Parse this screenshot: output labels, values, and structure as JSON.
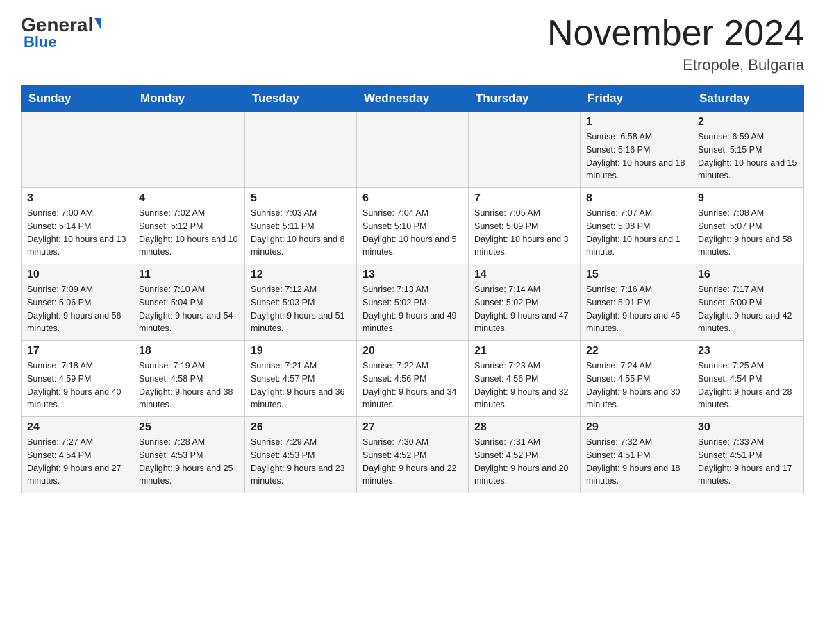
{
  "header": {
    "logo": {
      "general": "General",
      "blue": "Blue"
    },
    "title": "November 2024",
    "location": "Etropole, Bulgaria"
  },
  "weekdays": [
    "Sunday",
    "Monday",
    "Tuesday",
    "Wednesday",
    "Thursday",
    "Friday",
    "Saturday"
  ],
  "weeks": [
    [
      {
        "day": "",
        "sunrise": "",
        "sunset": "",
        "daylight": ""
      },
      {
        "day": "",
        "sunrise": "",
        "sunset": "",
        "daylight": ""
      },
      {
        "day": "",
        "sunrise": "",
        "sunset": "",
        "daylight": ""
      },
      {
        "day": "",
        "sunrise": "",
        "sunset": "",
        "daylight": ""
      },
      {
        "day": "",
        "sunrise": "",
        "sunset": "",
        "daylight": ""
      },
      {
        "day": "1",
        "sunrise": "Sunrise: 6:58 AM",
        "sunset": "Sunset: 5:16 PM",
        "daylight": "Daylight: 10 hours and 18 minutes."
      },
      {
        "day": "2",
        "sunrise": "Sunrise: 6:59 AM",
        "sunset": "Sunset: 5:15 PM",
        "daylight": "Daylight: 10 hours and 15 minutes."
      }
    ],
    [
      {
        "day": "3",
        "sunrise": "Sunrise: 7:00 AM",
        "sunset": "Sunset: 5:14 PM",
        "daylight": "Daylight: 10 hours and 13 minutes."
      },
      {
        "day": "4",
        "sunrise": "Sunrise: 7:02 AM",
        "sunset": "Sunset: 5:12 PM",
        "daylight": "Daylight: 10 hours and 10 minutes."
      },
      {
        "day": "5",
        "sunrise": "Sunrise: 7:03 AM",
        "sunset": "Sunset: 5:11 PM",
        "daylight": "Daylight: 10 hours and 8 minutes."
      },
      {
        "day": "6",
        "sunrise": "Sunrise: 7:04 AM",
        "sunset": "Sunset: 5:10 PM",
        "daylight": "Daylight: 10 hours and 5 minutes."
      },
      {
        "day": "7",
        "sunrise": "Sunrise: 7:05 AM",
        "sunset": "Sunset: 5:09 PM",
        "daylight": "Daylight: 10 hours and 3 minutes."
      },
      {
        "day": "8",
        "sunrise": "Sunrise: 7:07 AM",
        "sunset": "Sunset: 5:08 PM",
        "daylight": "Daylight: 10 hours and 1 minute."
      },
      {
        "day": "9",
        "sunrise": "Sunrise: 7:08 AM",
        "sunset": "Sunset: 5:07 PM",
        "daylight": "Daylight: 9 hours and 58 minutes."
      }
    ],
    [
      {
        "day": "10",
        "sunrise": "Sunrise: 7:09 AM",
        "sunset": "Sunset: 5:06 PM",
        "daylight": "Daylight: 9 hours and 56 minutes."
      },
      {
        "day": "11",
        "sunrise": "Sunrise: 7:10 AM",
        "sunset": "Sunset: 5:04 PM",
        "daylight": "Daylight: 9 hours and 54 minutes."
      },
      {
        "day": "12",
        "sunrise": "Sunrise: 7:12 AM",
        "sunset": "Sunset: 5:03 PM",
        "daylight": "Daylight: 9 hours and 51 minutes."
      },
      {
        "day": "13",
        "sunrise": "Sunrise: 7:13 AM",
        "sunset": "Sunset: 5:02 PM",
        "daylight": "Daylight: 9 hours and 49 minutes."
      },
      {
        "day": "14",
        "sunrise": "Sunrise: 7:14 AM",
        "sunset": "Sunset: 5:02 PM",
        "daylight": "Daylight: 9 hours and 47 minutes."
      },
      {
        "day": "15",
        "sunrise": "Sunrise: 7:16 AM",
        "sunset": "Sunset: 5:01 PM",
        "daylight": "Daylight: 9 hours and 45 minutes."
      },
      {
        "day": "16",
        "sunrise": "Sunrise: 7:17 AM",
        "sunset": "Sunset: 5:00 PM",
        "daylight": "Daylight: 9 hours and 42 minutes."
      }
    ],
    [
      {
        "day": "17",
        "sunrise": "Sunrise: 7:18 AM",
        "sunset": "Sunset: 4:59 PM",
        "daylight": "Daylight: 9 hours and 40 minutes."
      },
      {
        "day": "18",
        "sunrise": "Sunrise: 7:19 AM",
        "sunset": "Sunset: 4:58 PM",
        "daylight": "Daylight: 9 hours and 38 minutes."
      },
      {
        "day": "19",
        "sunrise": "Sunrise: 7:21 AM",
        "sunset": "Sunset: 4:57 PM",
        "daylight": "Daylight: 9 hours and 36 minutes."
      },
      {
        "day": "20",
        "sunrise": "Sunrise: 7:22 AM",
        "sunset": "Sunset: 4:56 PM",
        "daylight": "Daylight: 9 hours and 34 minutes."
      },
      {
        "day": "21",
        "sunrise": "Sunrise: 7:23 AM",
        "sunset": "Sunset: 4:56 PM",
        "daylight": "Daylight: 9 hours and 32 minutes."
      },
      {
        "day": "22",
        "sunrise": "Sunrise: 7:24 AM",
        "sunset": "Sunset: 4:55 PM",
        "daylight": "Daylight: 9 hours and 30 minutes."
      },
      {
        "day": "23",
        "sunrise": "Sunrise: 7:25 AM",
        "sunset": "Sunset: 4:54 PM",
        "daylight": "Daylight: 9 hours and 28 minutes."
      }
    ],
    [
      {
        "day": "24",
        "sunrise": "Sunrise: 7:27 AM",
        "sunset": "Sunset: 4:54 PM",
        "daylight": "Daylight: 9 hours and 27 minutes."
      },
      {
        "day": "25",
        "sunrise": "Sunrise: 7:28 AM",
        "sunset": "Sunset: 4:53 PM",
        "daylight": "Daylight: 9 hours and 25 minutes."
      },
      {
        "day": "26",
        "sunrise": "Sunrise: 7:29 AM",
        "sunset": "Sunset: 4:53 PM",
        "daylight": "Daylight: 9 hours and 23 minutes."
      },
      {
        "day": "27",
        "sunrise": "Sunrise: 7:30 AM",
        "sunset": "Sunset: 4:52 PM",
        "daylight": "Daylight: 9 hours and 22 minutes."
      },
      {
        "day": "28",
        "sunrise": "Sunrise: 7:31 AM",
        "sunset": "Sunset: 4:52 PM",
        "daylight": "Daylight: 9 hours and 20 minutes."
      },
      {
        "day": "29",
        "sunrise": "Sunrise: 7:32 AM",
        "sunset": "Sunset: 4:51 PM",
        "daylight": "Daylight: 9 hours and 18 minutes."
      },
      {
        "day": "30",
        "sunrise": "Sunrise: 7:33 AM",
        "sunset": "Sunset: 4:51 PM",
        "daylight": "Daylight: 9 hours and 17 minutes."
      }
    ]
  ]
}
